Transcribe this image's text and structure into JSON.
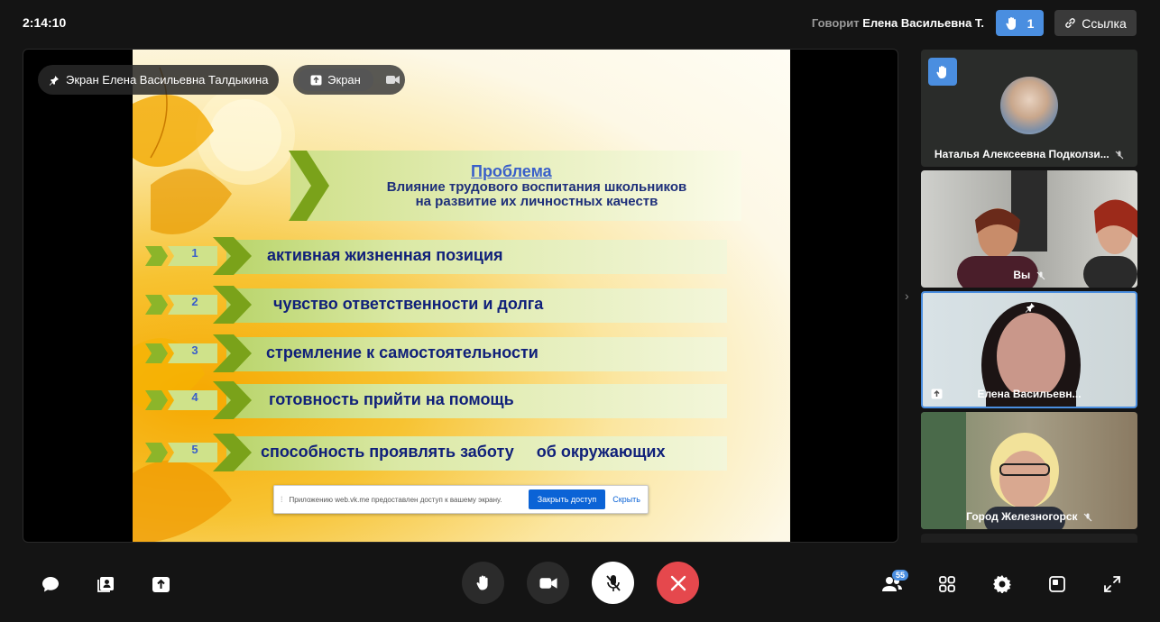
{
  "topbar": {
    "timer": "2:14:10",
    "speaking_label": "Говорит",
    "speaking_name": "Елена Васильевна Т.",
    "raised_hands_count": "1",
    "link_label": "Ссылка"
  },
  "stage": {
    "owner_label": "Экран Елена Васильевна Талдыкина",
    "screen_tab_label": "Экран",
    "slide": {
      "title": "Проблема",
      "subtitle_line1": "Влияние трудового воспитания школьников",
      "subtitle_line2": "на развитие их личностных  качеств",
      "items": [
        {
          "num": "1",
          "text": "активная жизненная позиция"
        },
        {
          "num": "2",
          "text": "чувство ответственности и долга"
        },
        {
          "num": "3",
          "text": "стремление к самостоятельности"
        },
        {
          "num": "4",
          "text": "готовность прийти на помощь"
        },
        {
          "num": "5",
          "text": "способность проявлять заботу     об окружающих"
        }
      ]
    },
    "notice": {
      "message": "Приложению web.vk.me предоставлен доступ к вашему экрану.",
      "close_access": "Закрыть доступ",
      "hide": "Скрыть"
    }
  },
  "participants": [
    {
      "name": "Наталья Алексеевна Подколзи...",
      "muted": true,
      "hand_raised": true
    },
    {
      "name": "Вы",
      "muted": true
    },
    {
      "name": "Елена Васильевн...",
      "muted": false,
      "pinned": true,
      "sharing": true
    },
    {
      "name": "Город Железногорск",
      "muted": true
    }
  ],
  "bottombar": {
    "participants_count": "55"
  },
  "colors": {
    "accent": "#4a8ee0",
    "end_call": "#e5484d",
    "background": "#141414"
  }
}
